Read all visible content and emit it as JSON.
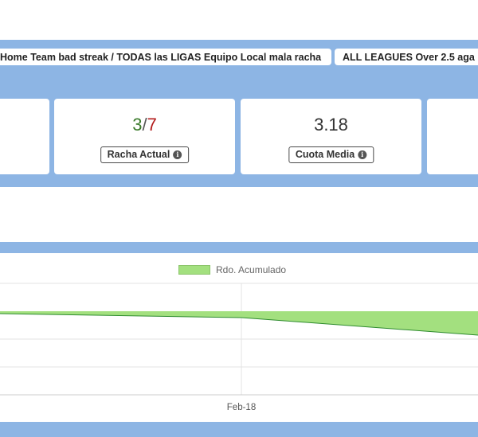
{
  "tabs": [
    {
      "label": "Home Team bad streak / TODAS las LIGAS Equipo Local mala racha"
    },
    {
      "label": "ALL LEAGUES Over 2.5 aga"
    }
  ],
  "stats": {
    "racha_actual": {
      "won": "3",
      "sep": "/",
      "total": "7",
      "label": "Racha Actual"
    },
    "cuota_media": {
      "value": "3.18",
      "label": "Cuota Media"
    }
  },
  "chart": {
    "legend": "Rdo. Acumulado",
    "x_tick": "Feb-18"
  },
  "chart_data": {
    "type": "area",
    "series": [
      {
        "name": "Rdo. Acumulado",
        "color": "#a3e07f"
      }
    ],
    "x_ticks": [
      "Feb-18"
    ],
    "grid": true,
    "legend_position": "top"
  },
  "colors": {
    "band": "#8db5e4",
    "area_fill": "#a3e07f",
    "line": "#2e8b2e",
    "positive": "#3a7a2a",
    "negative": "#b31b1b"
  }
}
